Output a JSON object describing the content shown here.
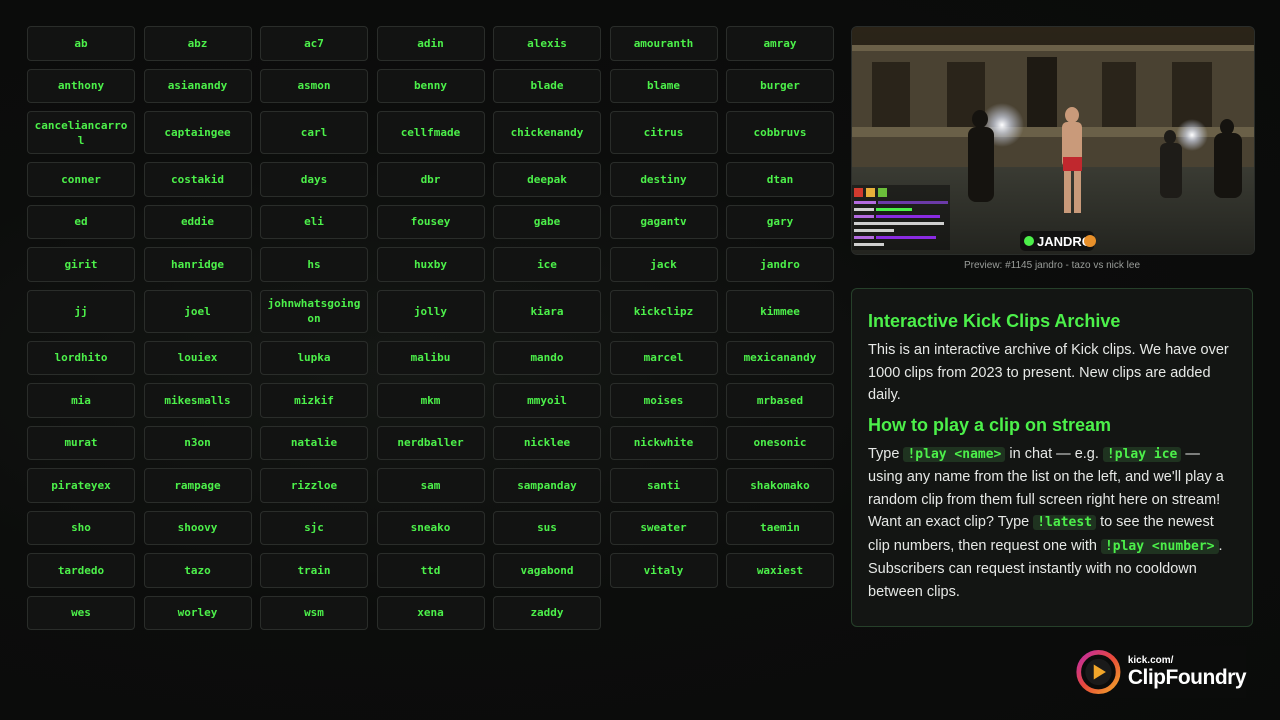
{
  "names": [
    "ab",
    "abz",
    "ac7",
    "adin",
    "alexis",
    "amouranth",
    "amray",
    "anthony",
    "asianandy",
    "asmon",
    "benny",
    "blade",
    "blame",
    "burger",
    "canceliancarrol",
    "captaingee",
    "carl",
    "cellfmade",
    "chickenandy",
    "citrus",
    "cobbruvs",
    "conner",
    "costakid",
    "days",
    "dbr",
    "deepak",
    "destiny",
    "dtan",
    "ed",
    "eddie",
    "eli",
    "fousey",
    "gabe",
    "gagantv",
    "gary",
    "girit",
    "hanridge",
    "hs",
    "huxby",
    "ice",
    "jack",
    "jandro",
    "jj",
    "joel",
    "johnwhatsgoingon",
    "jolly",
    "kiara",
    "kickclipz",
    "kimmee",
    "lordhito",
    "louiex",
    "lupka",
    "malibu",
    "mando",
    "marcel",
    "mexicanandy",
    "mia",
    "mikesmalls",
    "mizkif",
    "mkm",
    "mmyoil",
    "moises",
    "mrbased",
    "murat",
    "n3on",
    "natalie",
    "nerdballer",
    "nicklee",
    "nickwhite",
    "onesonic",
    "pirateyex",
    "rampage",
    "rizzloe",
    "sam",
    "sampanday",
    "santi",
    "shakomako",
    "sho",
    "shoovy",
    "sjc",
    "sneako",
    "sus",
    "sweater",
    "taemin",
    "tardedo",
    "tazo",
    "train",
    "ttd",
    "vagabond",
    "vitaly",
    "waxiest",
    "wes",
    "worley",
    "wsm",
    "xena",
    "zaddy"
  ],
  "preview": {
    "caption": "Preview: #1145 jandro - tazo vs nick lee",
    "watermark": "JANDRO"
  },
  "info": {
    "title1": "Interactive Kick Clips Archive",
    "desc": "This is an interactive archive of Kick clips. We have over 1000 clips from 2023 to present. New clips are added daily.",
    "title2": "How to play a clip on stream",
    "t_type": "Type",
    "c_play_name": "!play <name>",
    "t_eg": "in chat — e.g.",
    "c_play_ice": "!play ice",
    "t_using": "— using any name from the list on the left, and we'll play a random clip from them full screen right here on stream! Want an exact clip? Type",
    "c_latest": "!latest",
    "t_see": "to see the newest clip numbers, then request one with",
    "c_play_number": "!play <number>",
    "t_subs": ". Subscribers can request instantly with no cooldown between clips."
  },
  "logo": {
    "small": "kick.com/",
    "big": "ClipFoundry"
  },
  "colors": {
    "accent": "#4cf04a",
    "background": "#0b0c0b",
    "cell": "#121312"
  }
}
